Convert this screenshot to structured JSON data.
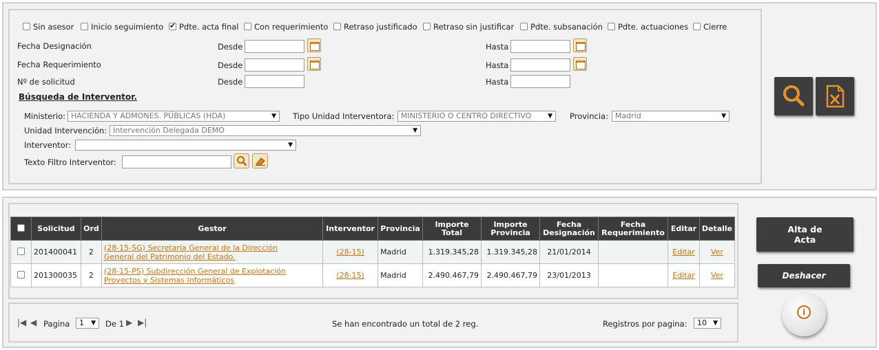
{
  "filters": {
    "checkboxes": [
      {
        "label": "Sin asesor",
        "checked": false
      },
      {
        "label": "Inicio seguimiento",
        "checked": false
      },
      {
        "label": "Pdte. acta final",
        "checked": true
      },
      {
        "label": "Con requerimiento",
        "checked": false
      },
      {
        "label": "Retraso justificado",
        "checked": false
      },
      {
        "label": "Retraso sin justificar",
        "checked": false
      },
      {
        "label": "Pdte. subsanación",
        "checked": false
      },
      {
        "label": "Pdte. actuaciones",
        "checked": false
      },
      {
        "label": "Cierre",
        "checked": false
      }
    ],
    "fecha_designacion": "Fecha Designación",
    "fecha_requerimiento": "Fecha Requerimiento",
    "num_solicitud": "Nº de solicitud",
    "desde": "Desde",
    "hasta": "Hasta",
    "busqueda_title": "Búsqueda de Interventor.",
    "ministerio_label": "Ministerio:",
    "ministerio_value": "HACIENDA Y ADMONES. PÚBLICAS (HDA)",
    "tipo_unidad_label": "Tipo Unidad Interventora:",
    "tipo_unidad_value": "MINISTERIO O CENTRO DIRECTIVO",
    "provincia_label": "Provincia:",
    "provincia_value": "Madrid",
    "unidad_label": "Unidad Intervención:",
    "unidad_value": "Intervención Delegada DEMO",
    "interventor_label": "Interventor:",
    "interventor_value": "",
    "texto_filtro_label": "Texto Filtro Interventor:",
    "texto_filtro_value": ""
  },
  "table": {
    "headers": [
      "Solicitud",
      "Ord",
      "Gestor",
      "Interventor",
      "Provincia",
      "Importe Total",
      "Importe Provincia",
      "Fecha Designación",
      "Fecha Requerimiento",
      "Editar",
      "Detalle"
    ],
    "rows": [
      {
        "solicitud": "201400041",
        "ord": "2",
        "gestor_line1": "(28-15-SG) Secretaría General de la Dirección",
        "gestor_line2": "General del Patrimonio del Estado.",
        "interventor": "(28-15)",
        "provincia": "Madrid",
        "importe_total": "1.319.345,28",
        "importe_provincia": "1.319.345,28",
        "fecha_designacion": "21/01/2014",
        "fecha_requerimiento": "",
        "editar": "Editar",
        "detalle": "Ver"
      },
      {
        "solicitud": "201300035",
        "ord": "2",
        "gestor_line1": "(28-15-PS) Subdirección General de Explotación",
        "gestor_line2": "Proyectos y Sistemas Informáticos",
        "interventor": "(28-15)",
        "provincia": "Madrid",
        "importe_total": "2.490.467,79",
        "importe_provincia": "2.490.467,79",
        "fecha_designacion": "23/01/2013",
        "fecha_requerimiento": "",
        "editar": "Editar",
        "detalle": "Ver"
      }
    ]
  },
  "pagination": {
    "pagina_label": "Pagina",
    "page_value": "1",
    "de_label": "De 1",
    "total_text": "Se han encontrado un total de 2 reg.",
    "registros_label": "Registros por pagina:",
    "registros_value": "10"
  },
  "actions": {
    "alta_line1": "Alta de",
    "alta_line2": "Acta",
    "deshacer": "Deshacer",
    "info_glyph": "i"
  },
  "colors": {
    "accent": "#c37516",
    "header_bg": "#3b3b3b",
    "panel_bg": "#f2f2f2"
  }
}
